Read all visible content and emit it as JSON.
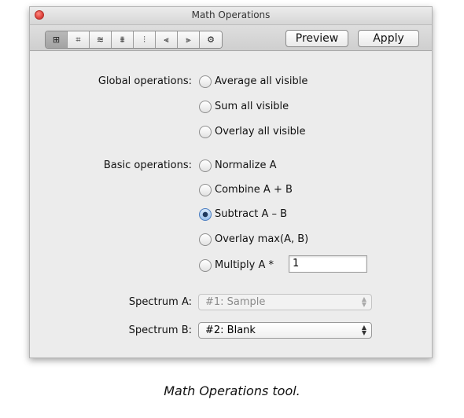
{
  "window": {
    "title": "Math Operations"
  },
  "toolbar": {
    "tools": [
      {
        "icon": "grid-icon",
        "glyph": "⊞"
      },
      {
        "icon": "crop-icon",
        "glyph": "⌗"
      },
      {
        "icon": "smooth-icon",
        "glyph": "≋"
      },
      {
        "icon": "baseline-icon",
        "glyph": "⩩"
      },
      {
        "icon": "peaks-icon",
        "glyph": "⫶"
      },
      {
        "icon": "peak-labels-icon",
        "glyph": "⫷"
      },
      {
        "icon": "integrate-icon",
        "glyph": "⫸"
      },
      {
        "icon": "settings-icon",
        "glyph": "⚙"
      }
    ],
    "preview_label": "Preview",
    "apply_label": "Apply"
  },
  "global": {
    "label": "Global operations:",
    "options": [
      "Average all visible",
      "Sum all visible",
      "Overlay all visible"
    ]
  },
  "basic": {
    "label": "Basic operations:",
    "options": [
      "Normalize A",
      "Combine A + B",
      "Subtract A – B",
      "Overlay max(A, B)",
      "Multiply A *"
    ],
    "selected": "Subtract A – B",
    "multiply_value": "1"
  },
  "spectrum_a": {
    "label": "Spectrum A:",
    "value": "#1: Sample",
    "disabled": true
  },
  "spectrum_b": {
    "label": "Spectrum B:",
    "value": "#2: Blank"
  },
  "caption": "Math Operations tool."
}
